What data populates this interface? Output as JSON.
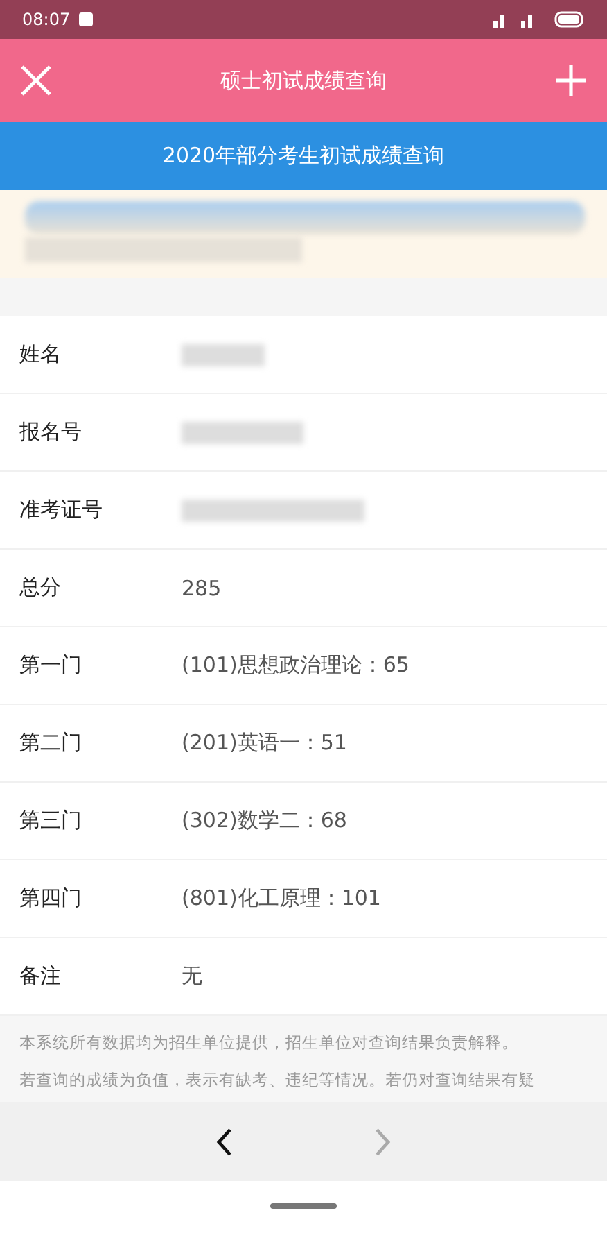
{
  "status_bar": {
    "time": "08:07"
  },
  "header": {
    "title": "硕士初试成绩查询"
  },
  "banner": {
    "title": "2020年部分考生初试成绩查询"
  },
  "rows": [
    {
      "label": "姓名",
      "redacted": true
    },
    {
      "label": "报名号",
      "redacted": true
    },
    {
      "label": "准考证号",
      "redacted": true
    },
    {
      "label": "总分",
      "value": "285",
      "redacted": false
    },
    {
      "label": "第一门",
      "value": "(101)思想政治理论：65",
      "redacted": false
    },
    {
      "label": "第二门",
      "value": "(201)英语一：51",
      "redacted": false
    },
    {
      "label": "第三门",
      "value": "(302)数学二：68",
      "redacted": false
    },
    {
      "label": "第四门",
      "value": "(801)化工原理：101",
      "redacted": false
    },
    {
      "label": "备注",
      "value": "无",
      "redacted": false
    }
  ],
  "footnote": [
    "本系统所有数据均为招生单位提供，招生单位对查询结果负责解释。",
    "若查询的成绩为负值，表示有缺考、违纪等情况。若仍对查询结果有疑"
  ],
  "nav": {
    "back_disabled": false,
    "forward_disabled": true
  }
}
